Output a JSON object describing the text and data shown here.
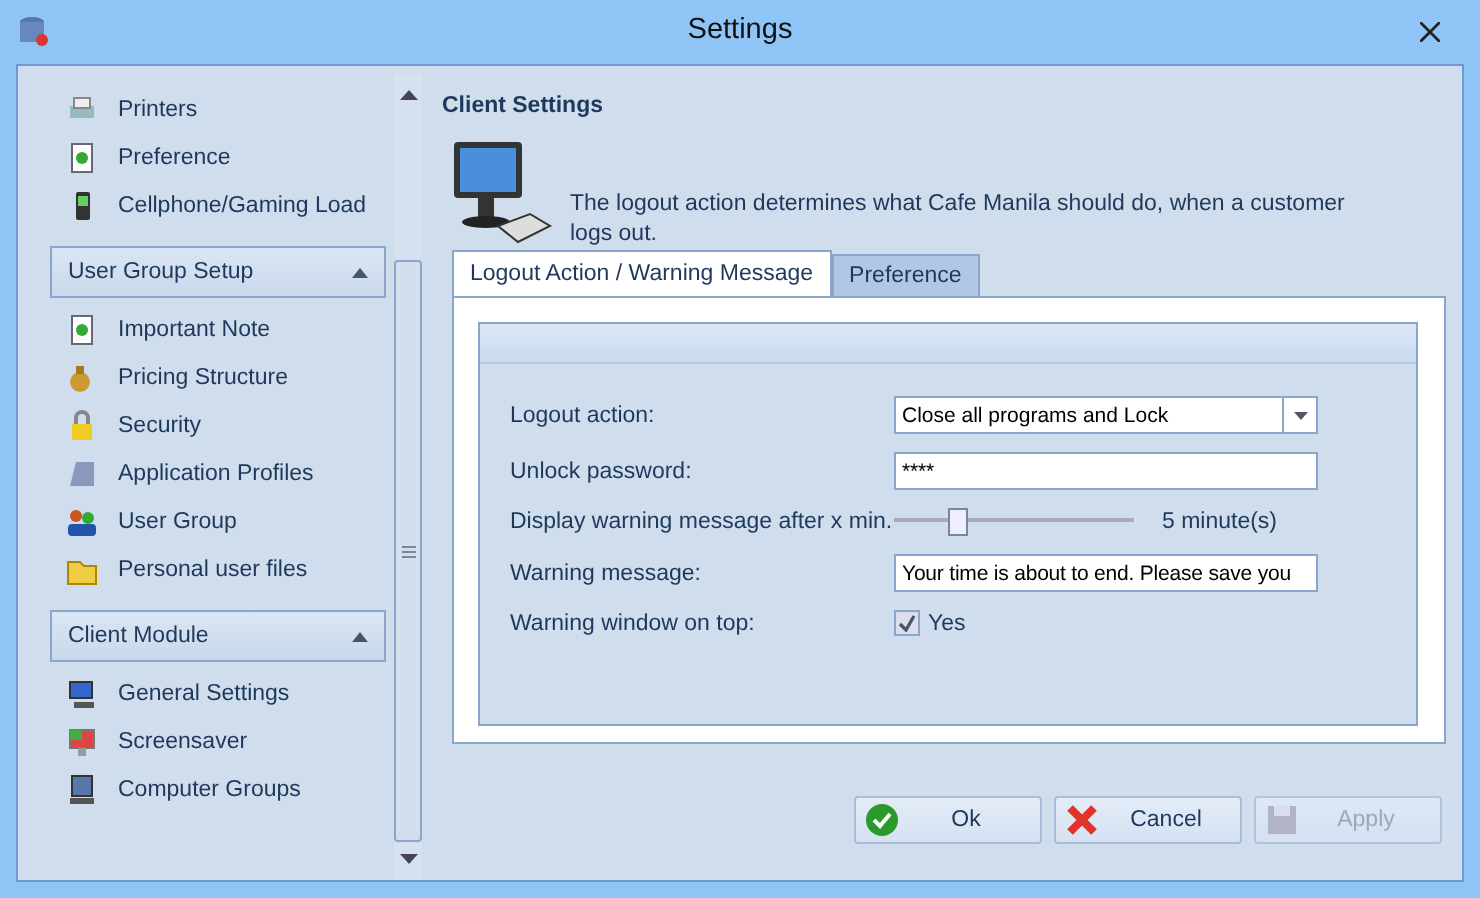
{
  "window": {
    "title": "Settings"
  },
  "sidebar": {
    "groups": [
      {
        "items": [
          "Printers",
          "Preference",
          "Cellphone/Gaming Load"
        ]
      },
      {
        "header": "User Group Setup",
        "expanded": true,
        "items": [
          "Important Note",
          "Pricing Structure",
          "Security",
          "Application Profiles",
          "User Group",
          "Personal user files"
        ]
      },
      {
        "header": "Client Module",
        "expanded": true,
        "items": [
          "General Settings",
          "Screensaver",
          "Computer Groups"
        ]
      }
    ]
  },
  "content": {
    "title": "Client Settings",
    "description": "The logout action determines what Cafe Manila should do, when a customer logs out.",
    "tabs": [
      {
        "label": "Logout Action / Warning Message",
        "selected": true
      },
      {
        "label": "Preference",
        "selected": false
      }
    ],
    "form": [
      {
        "kind": "dropdown",
        "label": "Logout action:",
        "value": "Close all programs and Lock"
      },
      {
        "kind": "text",
        "label": "Unlock password:",
        "value": "****"
      },
      {
        "kind": "slider",
        "label": "Display warning message after x min.",
        "level": 0.26,
        "reading": "5 minute(s)"
      },
      {
        "kind": "text",
        "label": "Warning message:",
        "value": "Your time is about to end. Please save you"
      },
      {
        "kind": "checkbox",
        "label": "Warning window on top:",
        "checked": true,
        "text": "Yes"
      }
    ]
  },
  "buttons": [
    {
      "label": "Ok",
      "kind": "ok",
      "disabled": false
    },
    {
      "label": "Cancel",
      "kind": "cancel",
      "disabled": false
    },
    {
      "label": "Apply",
      "kind": "save",
      "disabled": true
    }
  ]
}
